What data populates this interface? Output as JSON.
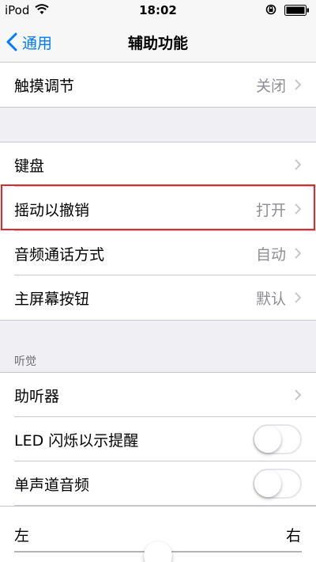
{
  "status": {
    "carrier": "iPod",
    "time": "18:02"
  },
  "nav": {
    "back_label": "通用",
    "title": "辅助功能"
  },
  "group1": {
    "touch_adjust": {
      "label": "触摸调节",
      "value": "关闭"
    }
  },
  "group2": {
    "keyboard": {
      "label": "键盘"
    },
    "shake_undo": {
      "label": "摇动以撤销",
      "value": "打开"
    },
    "call_audio": {
      "label": "音频通话方式",
      "value": "自动"
    },
    "home_button": {
      "label": "主屏幕按钮",
      "value": "默认"
    }
  },
  "hearing": {
    "header": "听觉",
    "hearing_aids": {
      "label": "助听器"
    },
    "led_flash": {
      "label": "LED 闪烁以示提醒",
      "on": false
    },
    "mono_audio": {
      "label": "单声道音频",
      "on": false
    },
    "balance": {
      "left": "左",
      "right": "右",
      "level": 0.5
    }
  },
  "colors": {
    "accent": "#007aff",
    "highlight": "#e0292b"
  },
  "icons": {
    "back": "chevron-left-icon",
    "row": "chevron-right-icon"
  }
}
